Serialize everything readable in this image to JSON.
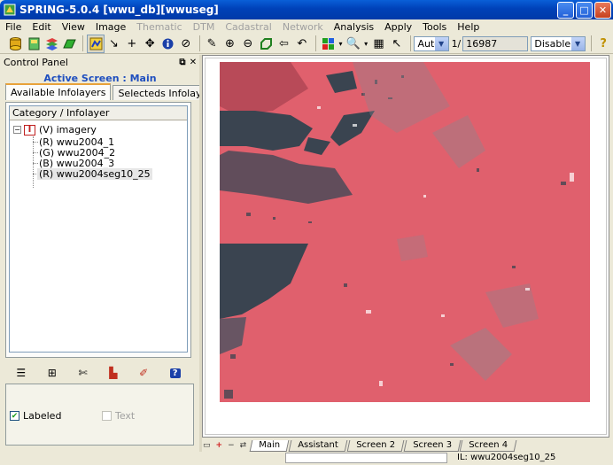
{
  "window": {
    "title": "SPRING-5.0.4 [wwu_db][wwuseg]",
    "minimize": "_",
    "maximize": "□",
    "close": "✕"
  },
  "menu": [
    "File",
    "Edit",
    "View",
    "Image",
    "Thematic",
    "DTM",
    "Cadastral",
    "Network",
    "Analysis",
    "Apply",
    "Tools",
    "Help"
  ],
  "menu_disabled": [
    "Thematic",
    "DTM",
    "Cadastral",
    "Network"
  ],
  "toolbar": {
    "zoom_mode": "Auto",
    "scale_prefix": "1/",
    "scale_value": "16987",
    "cursor_mode": "Disable"
  },
  "control_panel": {
    "title": "Control Panel",
    "active_screen": "Active Screen : Main",
    "tabs": [
      "Available Infolayers",
      "Selecteds Infolayers"
    ],
    "tree_header": "Category / Infolayer",
    "category_icon": "I",
    "category": "(V) imagery",
    "layers": [
      "(R) wwu2004_1",
      "(G) wwu2004_2",
      "(B) wwu2004_3",
      "(R) wwu2004seg10_25"
    ],
    "options": {
      "labeled": "Labeled",
      "text": "Text"
    }
  },
  "screen_tabs": [
    "Main",
    "Assistant",
    "Screen 2",
    "Screen 3",
    "Screen 4"
  ],
  "status": {
    "infolayer": "IL: wwu2004seg10_25"
  },
  "colors": {
    "title_bar": "#0054e3",
    "image_pink": "#e0606d",
    "image_dark": "#3a4450",
    "active_screen_text": "#1f4fbf"
  }
}
